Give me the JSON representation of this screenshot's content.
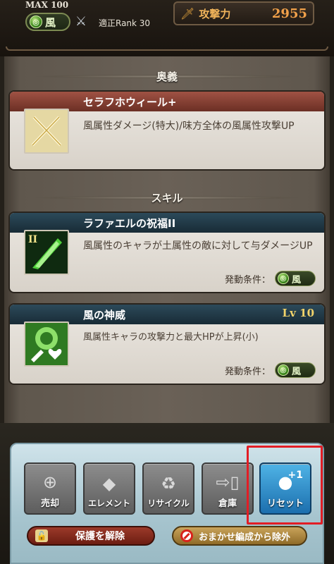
{
  "header": {
    "max_label": "MAX 100",
    "element_label": "風",
    "rank_label": "適正Rank 30",
    "attack_label": "攻撃力",
    "attack_value": "2955"
  },
  "sections": {
    "ougi_heading": "奥義",
    "skill_heading": "スキル"
  },
  "ougi": {
    "name": "セラフホウィール+",
    "description": "風属性ダメージ(特大)/味方全体の風属性攻撃UP",
    "icon": "crossed-swords-icon"
  },
  "skills": [
    {
      "name": "ラファエルの祝福II",
      "description": "風属性のキャラが土属性の敵に対して与ダメージUP",
      "condition_label": "発動条件：",
      "condition_value": "風",
      "icon": "green-blade-icon",
      "icon_badge": "II"
    },
    {
      "name": "風の神威",
      "level": "Lv 10",
      "description": "風属性キャラの攻撃力と最大HPが上昇(小)",
      "condition_label": "発動条件：",
      "condition_value": "風",
      "icon": "wind-attack-hp-icon"
    }
  ],
  "toolbar": {
    "sell": "売却",
    "element": "エレメント",
    "recycle": "リサイクル",
    "storage": "倉庫",
    "reset": "リセット",
    "reset_badge": "+1"
  },
  "actions": {
    "unprotect": "保護を解除",
    "exclude_auto": "おまかせ編成から除外"
  },
  "colors": {
    "highlight": "#e21d25",
    "reset_button": "#2b8fd0",
    "ougi_title": "#8a4234",
    "skill_title": "#223b48"
  }
}
